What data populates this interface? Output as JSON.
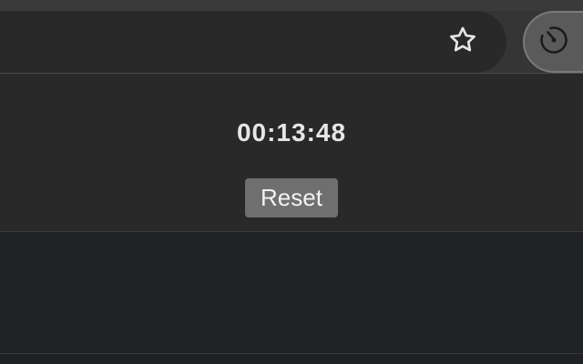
{
  "toolbar": {
    "bookmark_icon": "star-outline-icon",
    "extension_icon": "timer-icon"
  },
  "timer": {
    "time": "00:13:48",
    "reset_label": "Reset"
  },
  "colors": {
    "background": "#202124",
    "popup_background": "#292929",
    "button_background": "#6f6f6f",
    "text": "#e6e6e6"
  }
}
